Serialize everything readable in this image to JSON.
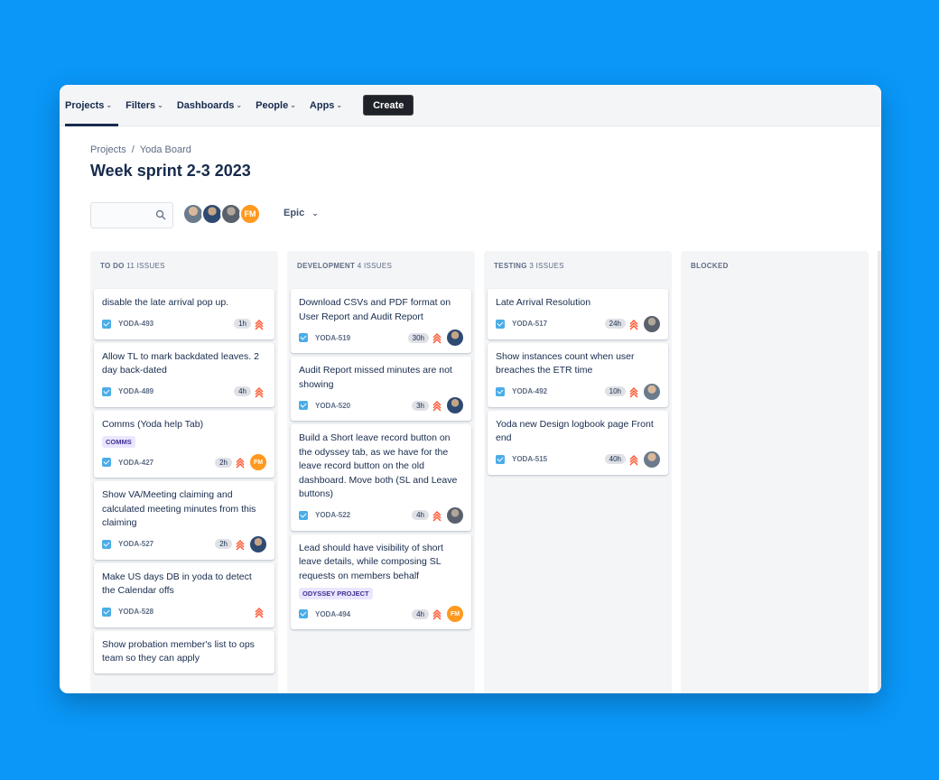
{
  "nav": {
    "items": [
      "Projects",
      "Filters",
      "Dashboards",
      "People",
      "Apps"
    ],
    "create": "Create"
  },
  "breadcrumb": {
    "root": "Projects",
    "separator": "/",
    "board": "Yoda Board"
  },
  "title": "Week sprint 2-3 2023",
  "search": {
    "placeholder": ""
  },
  "filters": {
    "avatar_initials": "FM",
    "epic": "Epic"
  },
  "columns": [
    {
      "name": "TO DO",
      "count": "11 ISSUES",
      "cards": [
        {
          "title": "disable the late arrival pop up.",
          "key": "YODA-493",
          "est": "1h",
          "avatar": ""
        },
        {
          "title": "Allow TL to mark backdated leaves. 2 day back-dated",
          "key": "YODA-489",
          "est": "4h",
          "avatar": ""
        },
        {
          "title": "Comms (Yoda help Tab)",
          "label": "COMMS",
          "key": "YODA-427",
          "est": "2h",
          "avatar": "FM"
        },
        {
          "title": "Show VA/Meeting claiming and calculated meeting minutes from this claiming",
          "key": "YODA-527",
          "est": "2h",
          "avatar": "photo2"
        },
        {
          "title": "Make US days DB in yoda to detect the Calendar offs",
          "key": "YODA-528",
          "est": "",
          "avatar": ""
        },
        {
          "title": "Show probation member's list to ops team so they can apply",
          "key": "",
          "est": "",
          "avatar": ""
        }
      ]
    },
    {
      "name": "DEVELOPMENT",
      "count": "4 ISSUES",
      "cards": [
        {
          "title": "Download CSVs and PDF format on User Report and Audit Report",
          "key": "YODA-519",
          "est": "30h",
          "avatar": "photo2"
        },
        {
          "title": "Audit Report missed minutes are not showing",
          "key": "YODA-520",
          "est": "3h",
          "avatar": "photo2"
        },
        {
          "title": "Build a Short leave record button on the odyssey tab, as we have for the leave record button on the old dashboard. Move both (SL and Leave buttons)",
          "key": "YODA-522",
          "est": "4h",
          "avatar": "photo3"
        },
        {
          "title": "Lead should have visibility of short leave details, while composing SL requests on members behalf",
          "label": "ODYSSEY PROJECT",
          "key": "YODA-494",
          "est": "4h",
          "avatar": "FM"
        }
      ]
    },
    {
      "name": "TESTING",
      "count": "3 ISSUES",
      "cards": [
        {
          "title": "Late Arrival Resolution",
          "key": "YODA-517",
          "est": "24h",
          "avatar": "photo3"
        },
        {
          "title": "Show instances count when user breaches the ETR time",
          "key": "YODA-492",
          "est": "10h",
          "avatar": "photo1"
        },
        {
          "title": "Yoda new Design logbook page Front end",
          "key": "YODA-515",
          "est": "40h",
          "avatar": "photo1"
        }
      ]
    },
    {
      "name": "BLOCKED",
      "count": "",
      "cards": []
    }
  ],
  "colors": {
    "background": "#0a97f8",
    "priority": "#ff5630",
    "checkbox": "#4bade8",
    "fm_avatar": "#ff991f"
  }
}
